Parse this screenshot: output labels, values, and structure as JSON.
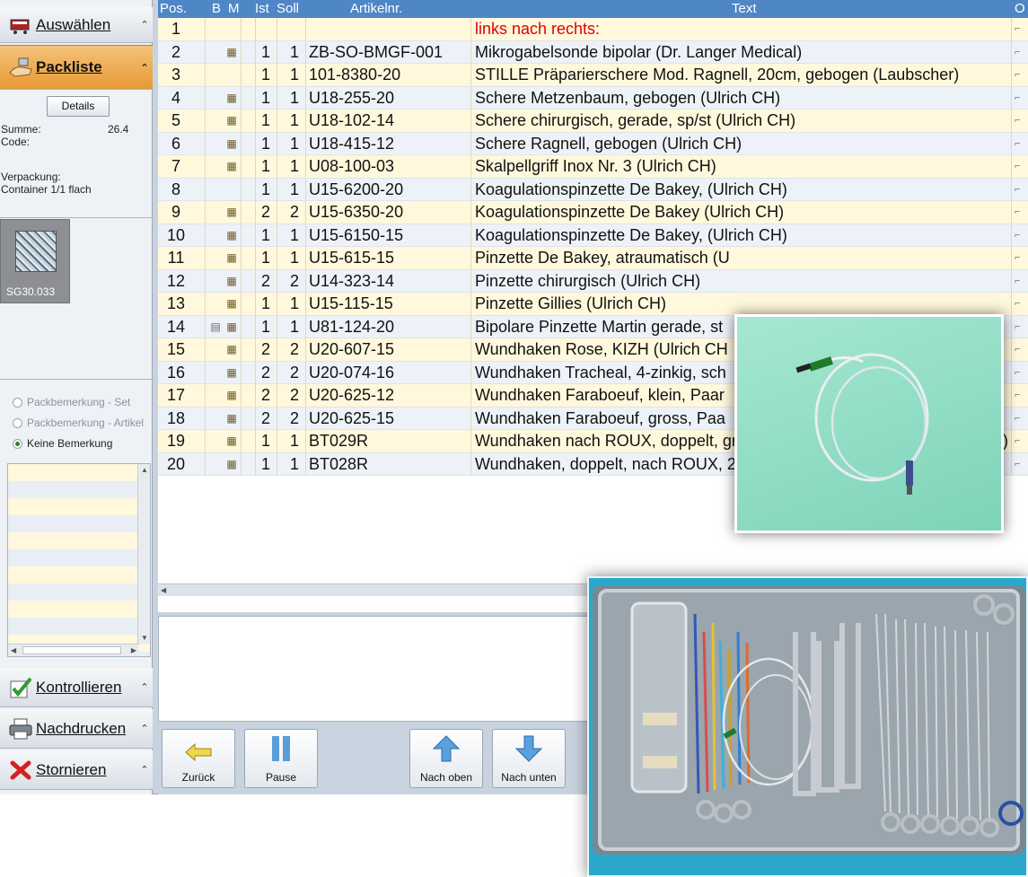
{
  "sidebar": {
    "auswaehlen": {
      "label": "Auswählen"
    },
    "packliste": {
      "label": "Packliste",
      "details_button": "Details",
      "summe_label": "Summe:",
      "summe_value": "26.4",
      "code_label": "Code:",
      "verpackung_label": "Verpackung:",
      "verpackung_value": "Container 1/1 flach",
      "thumbnail_label": "SG30.033",
      "radio_options": [
        {
          "label": "Packbemerkung - Set",
          "selected": false
        },
        {
          "label": "Packbemerkung - Artikel",
          "selected": false
        },
        {
          "label": "Keine Bemerkung",
          "selected": true
        }
      ]
    },
    "kontrollieren": {
      "label": "Kontrollieren"
    },
    "nachdrucken": {
      "label": "Nachdrucken"
    },
    "stornieren": {
      "label": "Stornieren"
    }
  },
  "grid": {
    "columns": [
      "Pos.",
      "B",
      "M",
      "Ist",
      "Soll",
      "Artikelnr.",
      "Text",
      "O"
    ],
    "rows": [
      {
        "pos": "1",
        "b": "",
        "m": "",
        "ist": "",
        "soll": "",
        "art": "",
        "text": "links nach rechts:",
        "red": true
      },
      {
        "pos": "2",
        "b": "",
        "m": "▦",
        "ist": "1",
        "soll": "1",
        "art": "ZB-SO-BMGF-001",
        "text": "Mikrogabelsonde bipolar (Dr. Langer Medical)"
      },
      {
        "pos": "3",
        "b": "",
        "m": "",
        "ist": "1",
        "soll": "1",
        "art": "101-8380-20",
        "text": "STILLE Präparierschere Mod. Ragnell, 20cm, gebogen (Laubscher)"
      },
      {
        "pos": "4",
        "b": "",
        "m": "▦",
        "ist": "1",
        "soll": "1",
        "art": "U18-255-20",
        "text": "Schere Metzenbaum, gebogen (Ulrich CH)"
      },
      {
        "pos": "5",
        "b": "",
        "m": "▦",
        "ist": "1",
        "soll": "1",
        "art": "U18-102-14",
        "text": "Schere chirurgisch, gerade, sp/st (Ulrich CH)"
      },
      {
        "pos": "6",
        "b": "",
        "m": "▦",
        "ist": "1",
        "soll": "1",
        "art": "U18-415-12",
        "text": "Schere Ragnell, gebogen (Ulrich CH)"
      },
      {
        "pos": "7",
        "b": "",
        "m": "▦",
        "ist": "1",
        "soll": "1",
        "art": "U08-100-03",
        "text": "Skalpellgriff Inox Nr. 3 (Ulrich CH)"
      },
      {
        "pos": "8",
        "b": "",
        "m": "",
        "ist": "1",
        "soll": "1",
        "art": "U15-6200-20",
        "text": "Koagulationspinzette De Bakey, (Ulrich CH)"
      },
      {
        "pos": "9",
        "b": "",
        "m": "▦",
        "ist": "2",
        "soll": "2",
        "art": "U15-6350-20",
        "text": "Koagulationspinzette De Bakey (Ulrich CH)"
      },
      {
        "pos": "10",
        "b": "",
        "m": "▦",
        "ist": "1",
        "soll": "1",
        "art": "U15-6150-15",
        "text": "Koagulationspinzette De Bakey, (Ulrich CH)"
      },
      {
        "pos": "11",
        "b": "",
        "m": "▦",
        "ist": "1",
        "soll": "1",
        "art": "U15-615-15",
        "text": "Pinzette De Bakey, atraumatisch (U"
      },
      {
        "pos": "12",
        "b": "",
        "m": "▦",
        "ist": "2",
        "soll": "2",
        "art": "U14-323-14",
        "text": "Pinzette chirurgisch (Ulrich CH)"
      },
      {
        "pos": "13",
        "b": "",
        "m": "▦",
        "ist": "1",
        "soll": "1",
        "art": "U15-115-15",
        "text": "Pinzette Gillies (Ulrich CH)"
      },
      {
        "pos": "14",
        "b": "▤",
        "m": "▦",
        "ist": "1",
        "soll": "1",
        "art": "U81-124-20",
        "text": "Bipolare Pinzette Martin gerade, st"
      },
      {
        "pos": "15",
        "b": "",
        "m": "▦",
        "ist": "2",
        "soll": "2",
        "art": "U20-607-15",
        "text": "Wundhaken Rose, KIZH (Ulrich CH"
      },
      {
        "pos": "16",
        "b": "",
        "m": "▦",
        "ist": "2",
        "soll": "2",
        "art": "U20-074-16",
        "text": "Wundhaken Tracheal, 4-zinkig, sch"
      },
      {
        "pos": "17",
        "b": "",
        "m": "▦",
        "ist": "2",
        "soll": "2",
        "art": "U20-625-12",
        "text": "Wundhaken Faraboeuf, klein, Paar"
      },
      {
        "pos": "18",
        "b": "",
        "m": "▦",
        "ist": "2",
        "soll": "2",
        "art": "U20-625-15",
        "text": "Wundhaken Faraboeuf, gross, Paa"
      },
      {
        "pos": "19",
        "b": "",
        "m": "▦",
        "ist": "1",
        "soll": "1",
        "art": "BT029R",
        "text": "Wundhaken nach ROUX, doppelt, gross, 190mm, 28x28/46x28 (Aesculap)"
      },
      {
        "pos": "20",
        "b": "",
        "m": "▦",
        "ist": "1",
        "soll": "1",
        "art": "BT028R",
        "text": "Wundhaken, doppelt, nach ROUX, 28x24/43x24mm (Aesculap)"
      }
    ]
  },
  "toolbar": {
    "zurueck": "Zurück",
    "pause": "Pause",
    "nach_oben": "Nach oben",
    "nach_unten": "Nach unten"
  },
  "icons": {
    "auswaehlen": "shopping-cart-icon",
    "packliste": "pack-hand-icon",
    "kontrollieren": "check-icon",
    "nachdrucken": "printer-icon",
    "stornieren": "cancel-x-icon"
  },
  "colors": {
    "grid_header": "#4f86c6",
    "row_odd": "#fff8dc",
    "row_even": "#edf2f9",
    "active_section": "#e69a35",
    "red_text": "#e00000"
  }
}
